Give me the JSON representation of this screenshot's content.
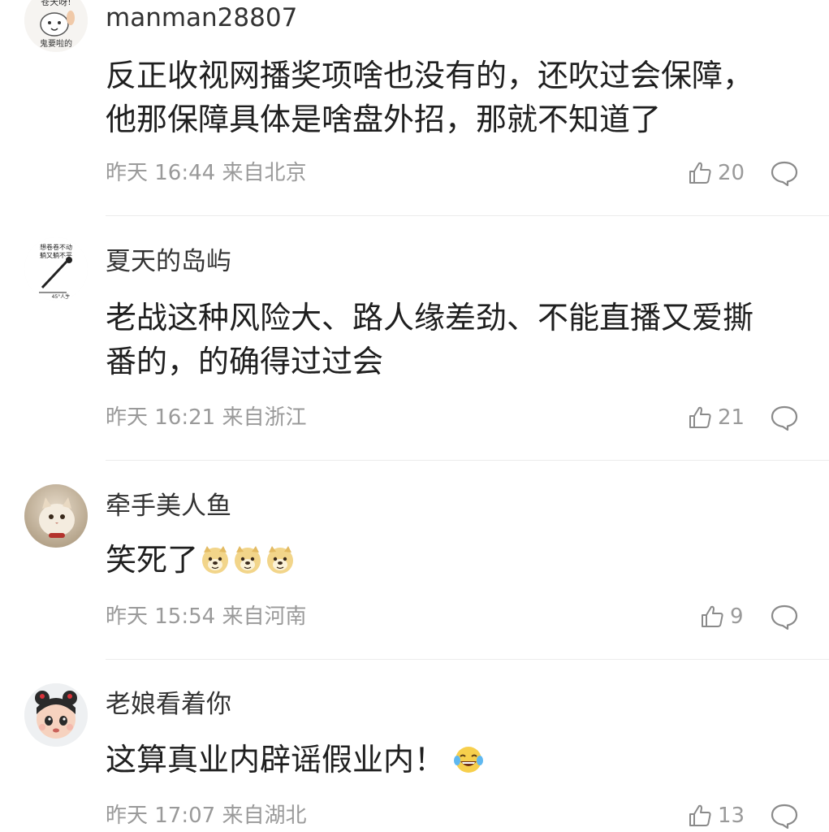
{
  "comments": [
    {
      "avatar_icon": "cartoon-cat-avatar",
      "username": "manman28807",
      "lines": [
        "反正收视网播奖项啥也没有的，还吹过会保障，",
        "他那保障具体是啥盘外招，那就不知道了"
      ],
      "meta": "昨天 16:44 来自北京",
      "likes": "20"
    },
    {
      "avatar_icon": "stick-figure-avatar",
      "avatar_text_top": "想卷卷不动",
      "avatar_text_mid": "躺又躺不平",
      "avatar_text_bottom": "45°人生",
      "username": "夏天的岛屿",
      "lines": [
        "老战这种风险大、路人缘差劲、不能直播又爱撕",
        "番的，的确得过过会"
      ],
      "meta": "昨天 16:21 来自浙江",
      "likes": "21"
    },
    {
      "avatar_icon": "kitten-photo-avatar",
      "username": "牵手美人鱼",
      "lines": [
        "笑死了"
      ],
      "emojis": [
        "doge-emoji",
        "doge-emoji",
        "doge-emoji"
      ],
      "meta": "昨天 15:54 来自河南",
      "likes": "9"
    },
    {
      "avatar_icon": "cartoon-girl-avatar",
      "username": "老娘看着你",
      "lines": [
        "这算真业内辟谣假业内！"
      ],
      "emojis": [
        "laughing-tears-emoji"
      ],
      "meta": "昨天 17:07 来自湖北",
      "likes": "13"
    }
  ],
  "colors": {
    "text_primary": "#1f1f1f",
    "text_meta": "#9a9a9a",
    "icon_gray": "#8a8a8a",
    "divider": "#ececec"
  }
}
